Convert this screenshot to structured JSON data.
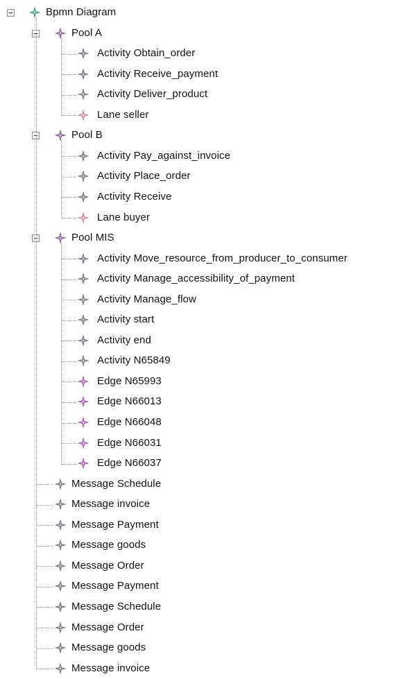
{
  "tree": {
    "root": {
      "label": "Bpmn Diagram",
      "icon": "diamond-star-green-icon",
      "expanded": true
    },
    "nodes": [
      {
        "label": "Pool A",
        "kind": "pool",
        "icon": "diamond-star-purple-icon",
        "expanded": true,
        "children": [
          {
            "label": "Activity Obtain_order",
            "icon": "diamond-star-gray-icon"
          },
          {
            "label": "Activity Receive_payment",
            "icon": "diamond-star-gray-icon"
          },
          {
            "label": "Activity Deliver_product",
            "icon": "diamond-star-gray-icon"
          },
          {
            "label": "Lane seller",
            "icon": "diamond-star-pink-icon"
          }
        ]
      },
      {
        "label": "Pool B",
        "kind": "pool",
        "icon": "diamond-star-purple-icon",
        "expanded": true,
        "children": [
          {
            "label": "Activity Pay_against_invoice",
            "icon": "diamond-star-gray-icon"
          },
          {
            "label": "Activity Place_order",
            "icon": "diamond-star-gray-icon"
          },
          {
            "label": "Activity Receive",
            "icon": "diamond-star-gray-icon"
          },
          {
            "label": "Lane buyer",
            "icon": "diamond-star-pink-icon"
          }
        ]
      },
      {
        "label": "Pool MIS",
        "kind": "pool",
        "icon": "diamond-star-purple-icon",
        "expanded": true,
        "children": [
          {
            "label": "Activity Move_resource_from_producer_to_consumer",
            "icon": "diamond-star-gray-icon"
          },
          {
            "label": "Activity Manage_accessibility_of_payment",
            "icon": "diamond-star-gray-icon"
          },
          {
            "label": "Activity Manage_flow",
            "icon": "diamond-star-gray-icon"
          },
          {
            "label": "Activity start",
            "icon": "diamond-star-gray-icon"
          },
          {
            "label": "Activity end",
            "icon": "diamond-star-gray-icon"
          },
          {
            "label": "Activity N65849",
            "icon": "diamond-star-gray-icon"
          },
          {
            "label": "Edge N65993",
            "icon": "diamond-star-violet-icon"
          },
          {
            "label": "Edge N66013",
            "icon": "diamond-star-violet-icon"
          },
          {
            "label": "Edge N66048",
            "icon": "diamond-star-violet-icon"
          },
          {
            "label": "Edge N66031",
            "icon": "diamond-star-violet-icon"
          },
          {
            "label": "Edge N66037",
            "icon": "diamond-star-violet-icon"
          }
        ]
      },
      {
        "label": "Message Schedule",
        "kind": "message",
        "icon": "diamond-star-gray-icon"
      },
      {
        "label": "Message invoice",
        "kind": "message",
        "icon": "diamond-star-gray-icon"
      },
      {
        "label": "Message Payment",
        "kind": "message",
        "icon": "diamond-star-gray-icon"
      },
      {
        "label": "Message goods",
        "kind": "message",
        "icon": "diamond-star-gray-icon"
      },
      {
        "label": "Message Order",
        "kind": "message",
        "icon": "diamond-star-gray-icon"
      },
      {
        "label": "Message Payment",
        "kind": "message",
        "icon": "diamond-star-gray-icon"
      },
      {
        "label": "Message Schedule",
        "kind": "message",
        "icon": "diamond-star-gray-icon"
      },
      {
        "label": "Message Order",
        "kind": "message",
        "icon": "diamond-star-gray-icon"
      },
      {
        "label": "Message goods",
        "kind": "message",
        "icon": "diamond-star-gray-icon"
      },
      {
        "label": "Message invoice",
        "kind": "message",
        "icon": "diamond-star-gray-icon"
      }
    ]
  },
  "colors": {
    "icon_green": "#3f9a78",
    "icon_purple": "#7a5a8c",
    "icon_gray": "#6f6f78",
    "icon_pink": "#c4849a",
    "icon_violet": "#9a5aa8",
    "tree_line": "#9a9a9a"
  }
}
